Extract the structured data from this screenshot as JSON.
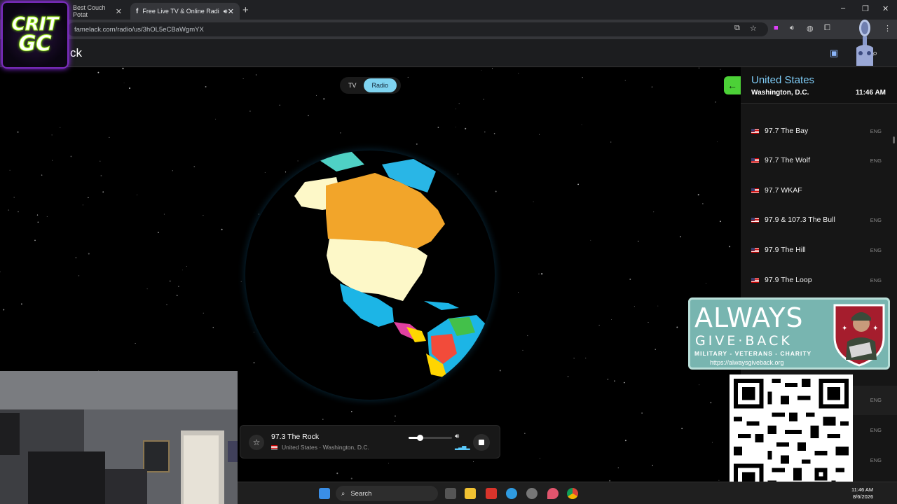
{
  "browser": {
    "tabs": [
      {
        "label": "Best Couch Potat",
        "active": false
      },
      {
        "label": "Free Live TV & Online Radi",
        "active": true
      }
    ],
    "url": "famelack.com/radio/us/3hOL5eCBaWgmYX"
  },
  "site": {
    "logo_partial": "ck"
  },
  "overlay": {
    "logo_line1": "CRIT",
    "logo_line2": "GC"
  },
  "toggle": {
    "tv_label": "TV",
    "radio_label": "Radio",
    "active": "Radio"
  },
  "panel": {
    "country": "United States",
    "city": "Washington, D.C.",
    "time": "11:46 AM",
    "stations": [
      {
        "name": "97.7 The Bay",
        "lang": "ENG"
      },
      {
        "name": "97.7 The Wolf",
        "lang": "ENG"
      },
      {
        "name": "97.7 WKAF",
        "lang": ""
      },
      {
        "name": "97.9 & 107.3 The Bull",
        "lang": "ENG"
      },
      {
        "name": "97.9 The Hill",
        "lang": "ENG"
      },
      {
        "name": "97.9 The Loop",
        "lang": "ENG"
      }
    ],
    "hidden_langs": [
      "ENG",
      "ENG",
      "ENG"
    ]
  },
  "player": {
    "station": "97.3 The Rock",
    "location": "United States · Washington, D.C.",
    "volume": 0.25
  },
  "ad": {
    "line1": "ALWAYS",
    "line2": "GIVE·BACK",
    "line3": "MILITARY - VETERANS - CHARITY",
    "url": "https://alwaysgiveback.org"
  },
  "taskbar": {
    "search_label": "Search",
    "time": "11:46 AM",
    "date": "8/6/2026"
  },
  "colors": {
    "accent": "#7fd3f0",
    "back_button": "#4cd137",
    "country_text": "#7ecbf5"
  }
}
